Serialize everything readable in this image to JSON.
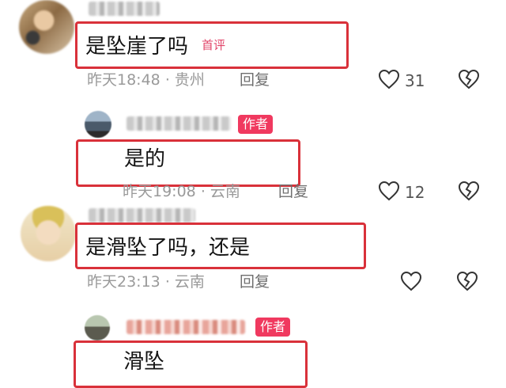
{
  "comments": [
    {
      "text": "是坠崖了吗",
      "badge": "首评",
      "time": "昨天18:48",
      "sep": "·",
      "location": "贵州",
      "reply": "回复",
      "likes": "31"
    },
    {
      "text": "是的",
      "badge": "作者",
      "time": "昨天19:08",
      "sep": "·",
      "location": "云南",
      "reply": "回复",
      "likes": "12"
    },
    {
      "text": "是滑坠了吗，还是",
      "time": "昨天23:13",
      "sep": "·",
      "location": "云南",
      "reply": "回复"
    },
    {
      "text": "滑坠",
      "badge": "作者"
    }
  ],
  "colors": {
    "highlight": "#d9313a",
    "author_badge": "#f0395f",
    "first_badge_text": "#e1466a"
  },
  "icons": {
    "like": "heart-outline-icon",
    "dislike": "broken-heart-icon"
  }
}
